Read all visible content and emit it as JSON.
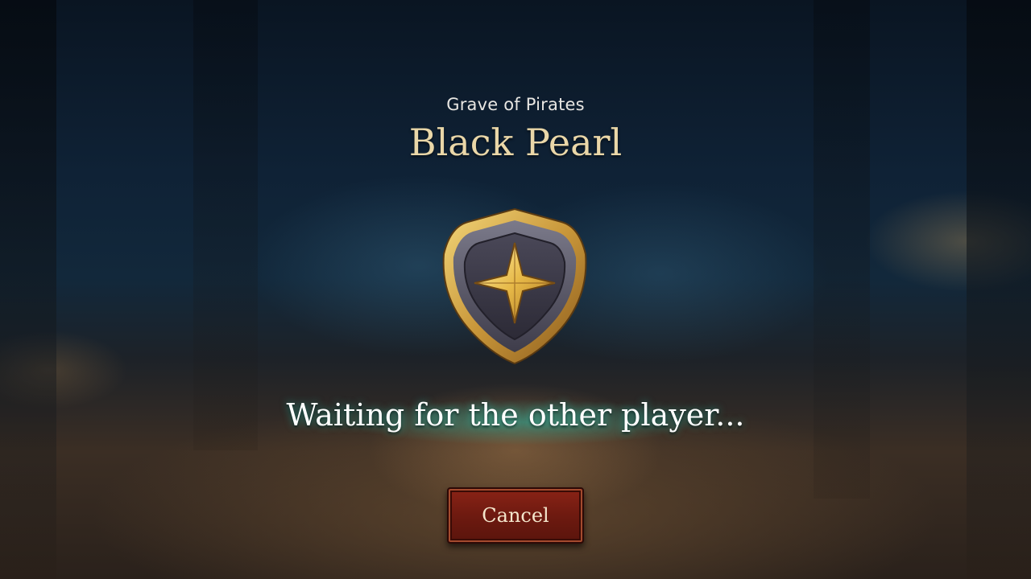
{
  "header": {
    "subtitle": "Grave of Pirates",
    "title": "Black Pearl"
  },
  "emblem": {
    "icon": "shield-star-icon"
  },
  "status": {
    "text": "Waiting for the other player..."
  },
  "actions": {
    "cancel_label": "Cancel"
  },
  "colors": {
    "title": "#ead7a8",
    "button": "#7a1f12",
    "glow": "#28c8b4"
  }
}
